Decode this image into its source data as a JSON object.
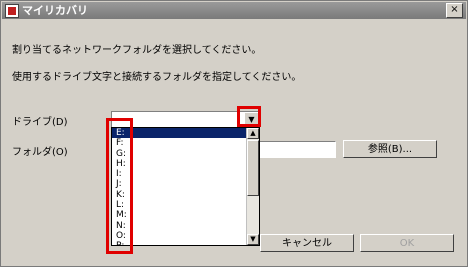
{
  "window": {
    "title": "マイリカバリ"
  },
  "title_close": "×",
  "instructions": {
    "line1": "割り当てるネットワークフォルダを選択してください。",
    "line2": "使用するドライブ文字と接続するフォルダを指定してください。"
  },
  "drive": {
    "label": "ドライブ(D)",
    "dropdown_arrow": "▼",
    "options": [
      "E:",
      "F:",
      "G:",
      "H:",
      "I:",
      "J:",
      "K:",
      "L:",
      "M:",
      "N:",
      "O:",
      "P:"
    ],
    "selected_index": 0
  },
  "folder": {
    "label": "フォルダ(O)",
    "value": ""
  },
  "buttons": {
    "browse": "参照(B)...",
    "cancel": "キャンセル",
    "ok": "OK"
  },
  "scroll_arrows": {
    "up": "▲",
    "down": "▼"
  },
  "colors": {
    "highlight_box": "#e00000",
    "selection": "#0a246a",
    "dialog_bg": "#d4d0c8"
  }
}
